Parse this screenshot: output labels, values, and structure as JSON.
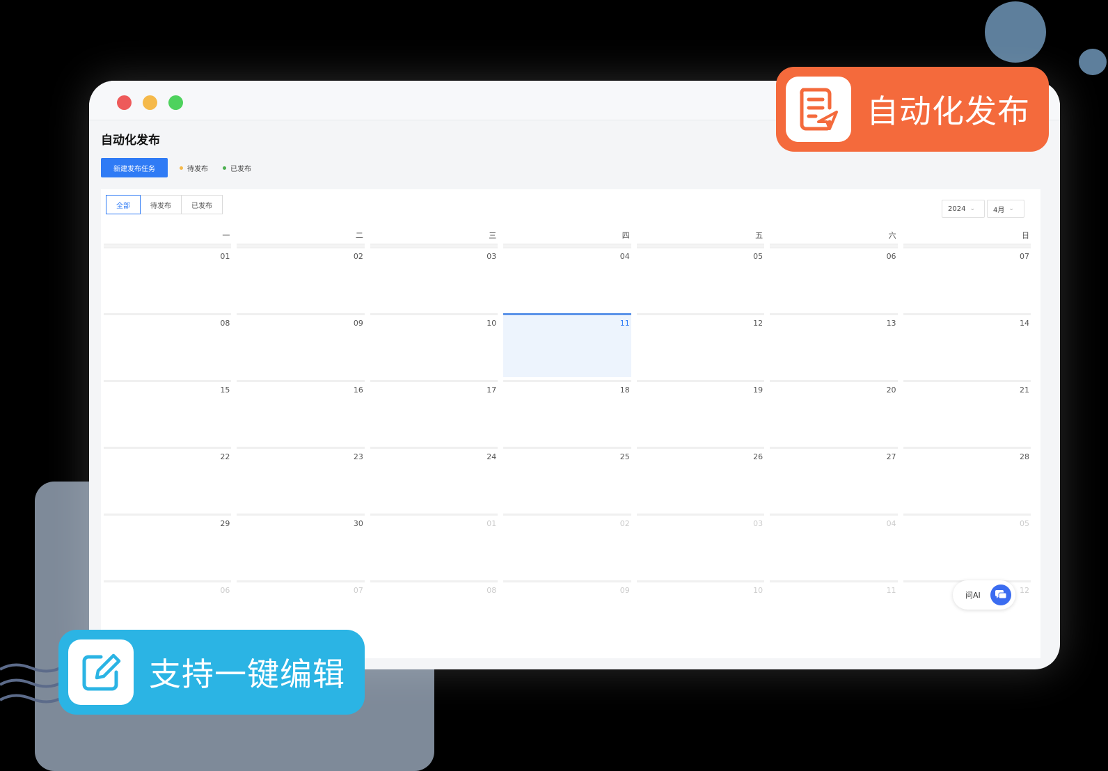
{
  "page_title": "自动化发布",
  "toolbar": {
    "new_task_label": "新建发布任务",
    "legend_pending": "待发布",
    "legend_published": "已发布",
    "legend_pending_color": "#f5b94a",
    "legend_published_color": "#4caf50"
  },
  "filter_tabs": [
    {
      "label": "全部",
      "active": true
    },
    {
      "label": "待发布",
      "active": false
    },
    {
      "label": "已发布",
      "active": false
    }
  ],
  "year_select": "2024",
  "month_select": "4月",
  "weekdays": [
    "一",
    "二",
    "三",
    "四",
    "五",
    "六",
    "日"
  ],
  "calendar_rows": [
    [
      {
        "d": "01"
      },
      {
        "d": "02"
      },
      {
        "d": "03"
      },
      {
        "d": "04"
      },
      {
        "d": "05"
      },
      {
        "d": "06"
      },
      {
        "d": "07"
      }
    ],
    [
      {
        "d": "08"
      },
      {
        "d": "09"
      },
      {
        "d": "10"
      },
      {
        "d": "11",
        "today": true
      },
      {
        "d": "12"
      },
      {
        "d": "13"
      },
      {
        "d": "14"
      }
    ],
    [
      {
        "d": "15"
      },
      {
        "d": "16"
      },
      {
        "d": "17"
      },
      {
        "d": "18"
      },
      {
        "d": "19"
      },
      {
        "d": "20"
      },
      {
        "d": "21"
      }
    ],
    [
      {
        "d": "22"
      },
      {
        "d": "23"
      },
      {
        "d": "24"
      },
      {
        "d": "25"
      },
      {
        "d": "26"
      },
      {
        "d": "27"
      },
      {
        "d": "28"
      }
    ],
    [
      {
        "d": "29"
      },
      {
        "d": "30"
      },
      {
        "d": "01",
        "other": true
      },
      {
        "d": "02",
        "other": true
      },
      {
        "d": "03",
        "other": true
      },
      {
        "d": "04",
        "other": true
      },
      {
        "d": "05",
        "other": true
      }
    ],
    [
      {
        "d": "06",
        "other": true
      },
      {
        "d": "07",
        "other": true
      },
      {
        "d": "08",
        "other": true
      },
      {
        "d": "09",
        "other": true
      },
      {
        "d": "10",
        "other": true
      },
      {
        "d": "11",
        "other": true
      },
      {
        "d": "12",
        "other": true
      }
    ]
  ],
  "ask_ai_label": "问AI",
  "badges": {
    "auto_publish": "自动化发布",
    "one_click_edit": "支持一键编辑"
  },
  "colors": {
    "accent": "#2f7bf5",
    "badge_orange": "#f46a3c",
    "badge_blue": "#2bb4e4"
  },
  "icons": {
    "auto_publish": "document-send-icon",
    "one_click_edit": "edit-pencil-icon",
    "ask_ai": "chat-bubble-icon"
  }
}
